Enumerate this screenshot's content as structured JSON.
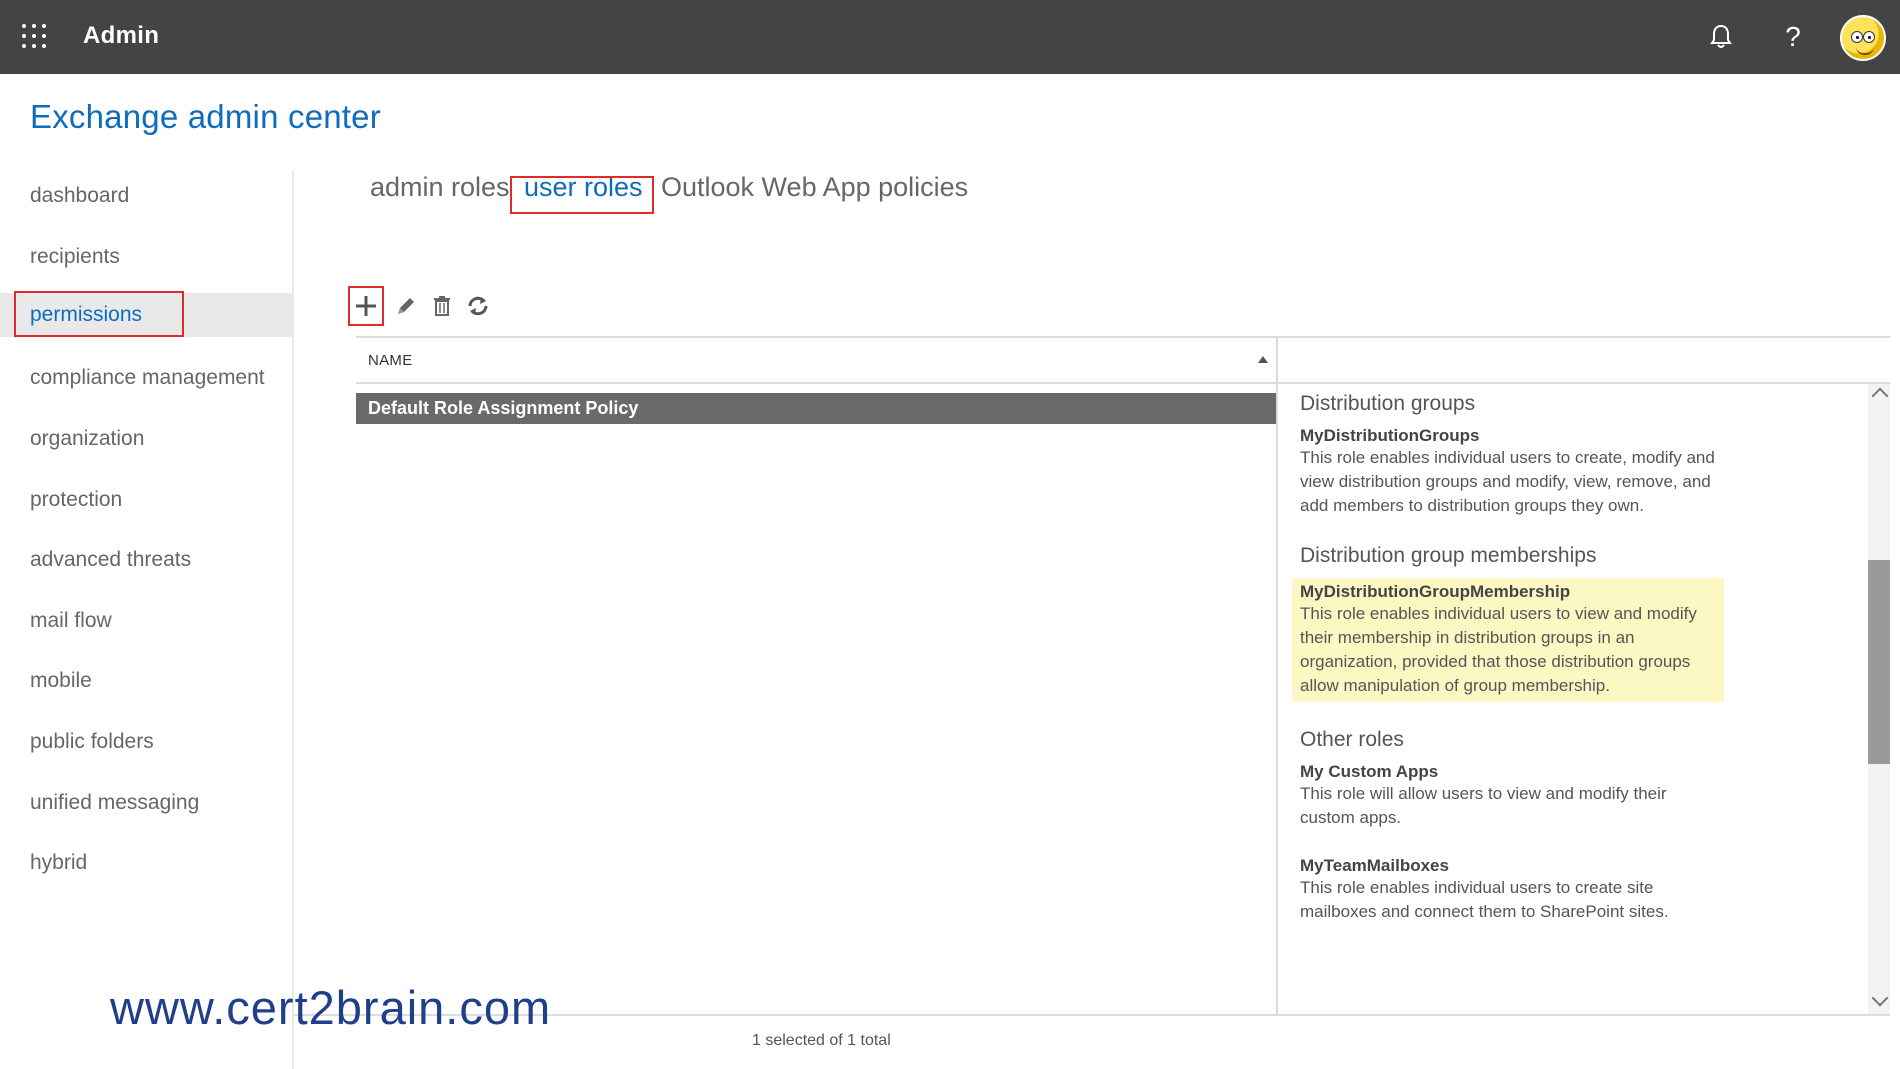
{
  "topbar": {
    "app_name": "Admin",
    "icons": [
      "app-launcher-icon",
      "bell-icon",
      "help-icon",
      "avatar"
    ],
    "help_glyph": "?"
  },
  "page": {
    "title": "Exchange admin center"
  },
  "sidebar": {
    "items": [
      {
        "label": "dashboard"
      },
      {
        "label": "recipients"
      },
      {
        "label": "permissions",
        "active": true
      },
      {
        "label": "compliance management"
      },
      {
        "label": "organization"
      },
      {
        "label": "protection"
      },
      {
        "label": "advanced threats"
      },
      {
        "label": "mail flow"
      },
      {
        "label": "mobile"
      },
      {
        "label": "public folders"
      },
      {
        "label": "unified messaging"
      },
      {
        "label": "hybrid"
      }
    ]
  },
  "tabs": [
    {
      "label": "admin roles"
    },
    {
      "label": "user roles",
      "selected": true
    },
    {
      "label": "Outlook Web App policies"
    }
  ],
  "toolbar": {
    "icons": [
      "add-icon",
      "edit-icon",
      "delete-icon",
      "refresh-icon"
    ]
  },
  "list": {
    "column_header": "NAME",
    "rows": [
      "Default Role Assignment Policy"
    ],
    "status": "1 selected of 1 total"
  },
  "details": {
    "sections": [
      {
        "title": "Distribution groups",
        "roles": [
          {
            "name": "MyDistributionGroups",
            "description": "This role enables individual users to create, modify and view distribution groups and modify, view, remove, and add members to distribution groups they own."
          }
        ]
      },
      {
        "title": "Distribution group memberships",
        "roles": [
          {
            "name": "MyDistributionGroupMembership",
            "description": "This role enables individual users to view and modify their membership in distribution groups in an organization, provided that those distribution groups allow manipulation of group membership.",
            "highlighted": true
          }
        ]
      },
      {
        "title": "Other roles",
        "roles": [
          {
            "name": "My Custom Apps",
            "description": "This role will allow users to view and modify their custom apps."
          },
          {
            "name": "MyTeamMailboxes",
            "description": "This role enables individual users to create site mailboxes and connect them to SharePoint sites."
          }
        ]
      }
    ]
  },
  "watermark": "www.cert2brain.com",
  "colors": {
    "topbar": "#444444",
    "accent": "#0f6cbd",
    "highlight_box": "#e02b2b",
    "row_selected": "#6a6a6a",
    "role_highlight": "#fbf8c3"
  }
}
